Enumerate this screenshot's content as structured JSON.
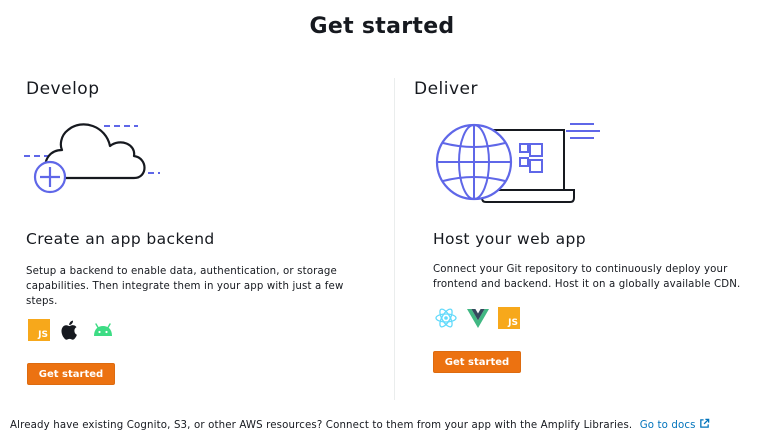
{
  "header": {
    "title": "Get started"
  },
  "develop": {
    "section_title": "Develop",
    "card_title": "Create an app backend",
    "description": "Setup a backend to enable data, authentication, or storage capabilities. Then integrate them in your app with just a few steps.",
    "platform_icons": [
      {
        "name": "javascript-icon",
        "label": "JS"
      },
      {
        "name": "apple-icon"
      },
      {
        "name": "android-icon"
      }
    ],
    "button_label": "Get started"
  },
  "deliver": {
    "section_title": "Deliver",
    "card_title": "Host your web app",
    "description": "Connect your Git repository to continuously deploy your frontend and backend. Host it on a globally available CDN.",
    "platform_icons": [
      {
        "name": "react-icon"
      },
      {
        "name": "vue-icon"
      },
      {
        "name": "javascript-icon",
        "label": "JS"
      }
    ],
    "button_label": "Get started"
  },
  "footer": {
    "text": "Already have existing Cognito, S3, or other AWS resources? Connect to them from your app with the Amplify Libraries.",
    "link_label": "Go to docs"
  },
  "colors": {
    "accent_button": "#ec7211",
    "link": "#0073bb",
    "illustration_stroke": "#5f67e8",
    "javascript_badge": "#f7a81b",
    "android_green": "#3ddc84",
    "vue_green": "#41b883",
    "vue_dark": "#35495e",
    "react_blue": "#61dafb"
  }
}
